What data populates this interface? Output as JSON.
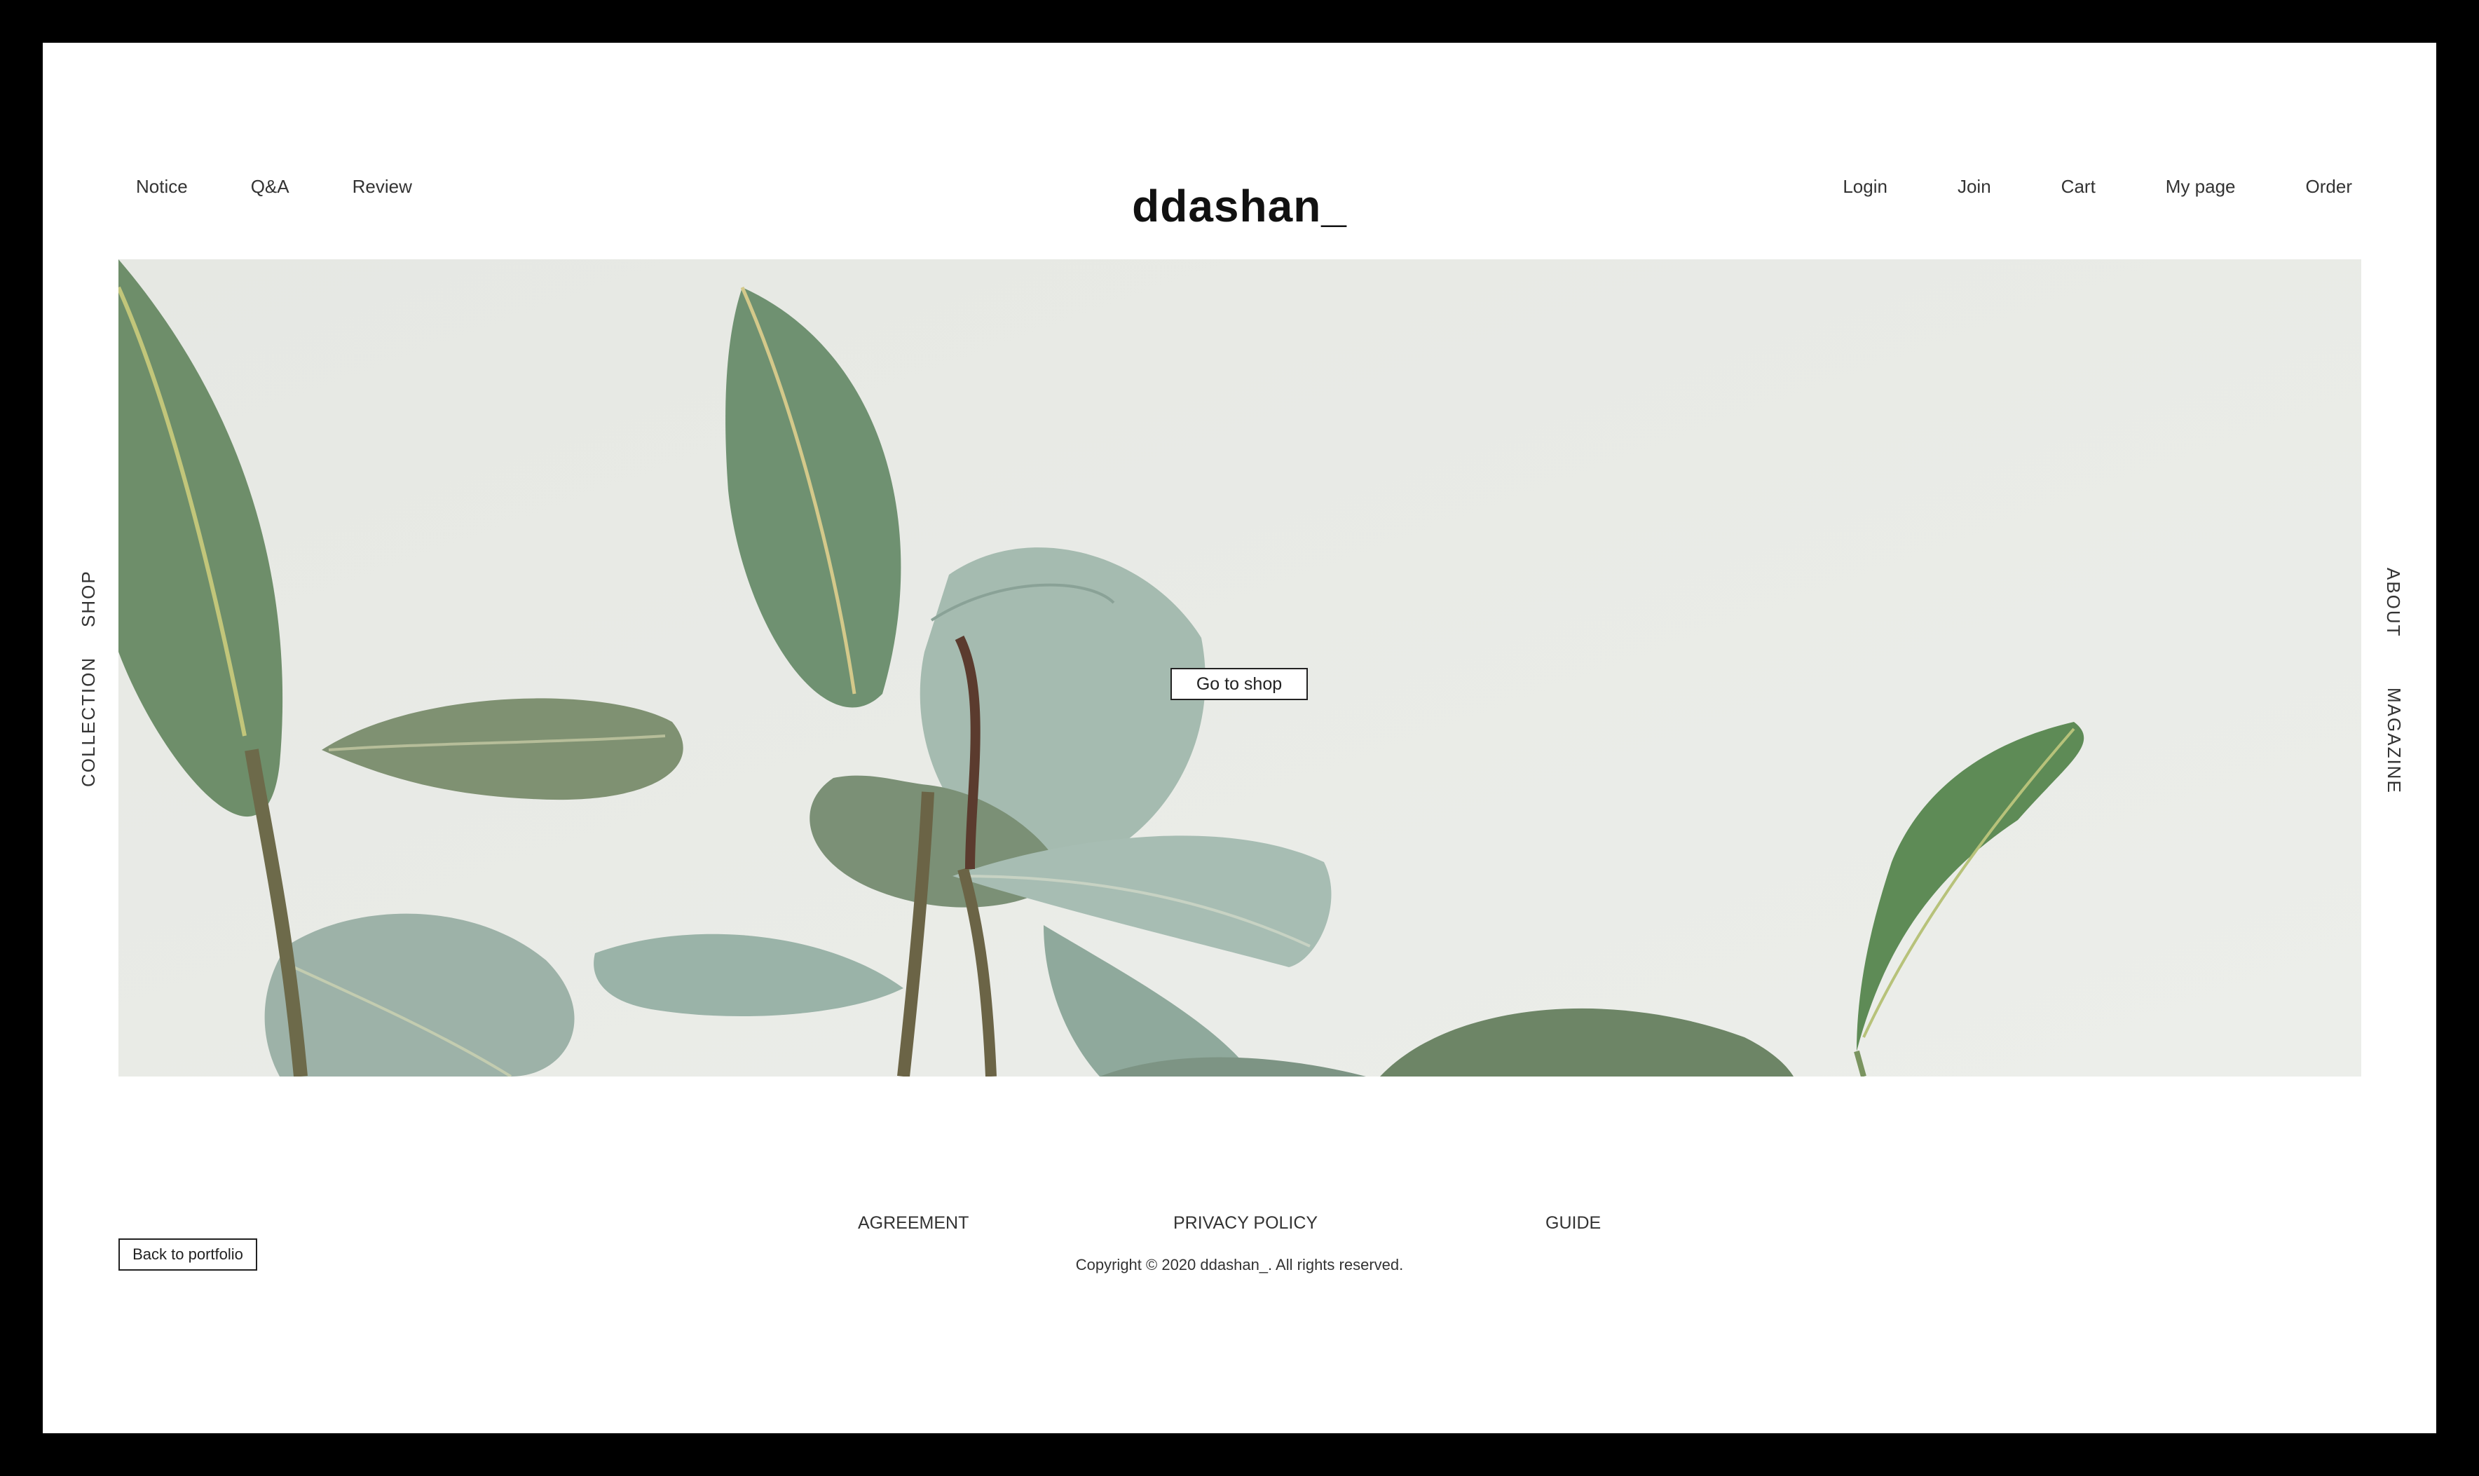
{
  "header": {
    "logo": "ddashan_",
    "left_nav": [
      {
        "label": "Notice"
      },
      {
        "label": "Q&A"
      },
      {
        "label": "Review"
      }
    ],
    "right_nav": [
      {
        "label": "Login"
      },
      {
        "label": "Join"
      },
      {
        "label": "Cart"
      },
      {
        "label": "My page"
      },
      {
        "label": "Order"
      }
    ]
  },
  "side_nav": {
    "left": [
      {
        "label": "SHOP"
      },
      {
        "label": "COLLECTION"
      }
    ],
    "right": [
      {
        "label": "ABOUT"
      },
      {
        "label": "MAGAZINE"
      }
    ]
  },
  "hero": {
    "cta_label": "Go to shop",
    "image_icon": "rubber-plant-photo"
  },
  "footer": {
    "links": [
      {
        "label": "AGREEMENT"
      },
      {
        "label": "PRIVACY POLICY"
      },
      {
        "label": "GUIDE"
      }
    ],
    "copyright": "Copyright © 2020 ddashan_. All rights reserved.",
    "back_label": "Back to portfolio"
  },
  "colors": {
    "frame": "#000000",
    "page_bg": "#ffffff",
    "hero_bg": "#e9ebe6",
    "leaf_dark": "#5d7f5e",
    "leaf_light": "#a9c0b4"
  }
}
